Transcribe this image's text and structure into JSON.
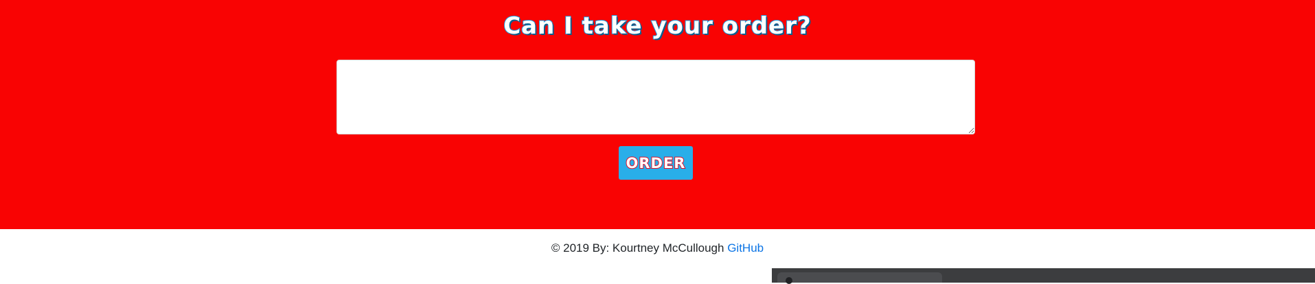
{
  "hero": {
    "background_color": "#f90303",
    "headline": "Can I take your order?",
    "order_input": {
      "value": "",
      "placeholder": ""
    },
    "order_button_label": "ORDER",
    "order_button_color": "#29aee9"
  },
  "footer": {
    "copyright_text": "© 2019 By: Kourtney McCullough",
    "link_label": "GitHub",
    "link_color": "#0b74e5"
  }
}
